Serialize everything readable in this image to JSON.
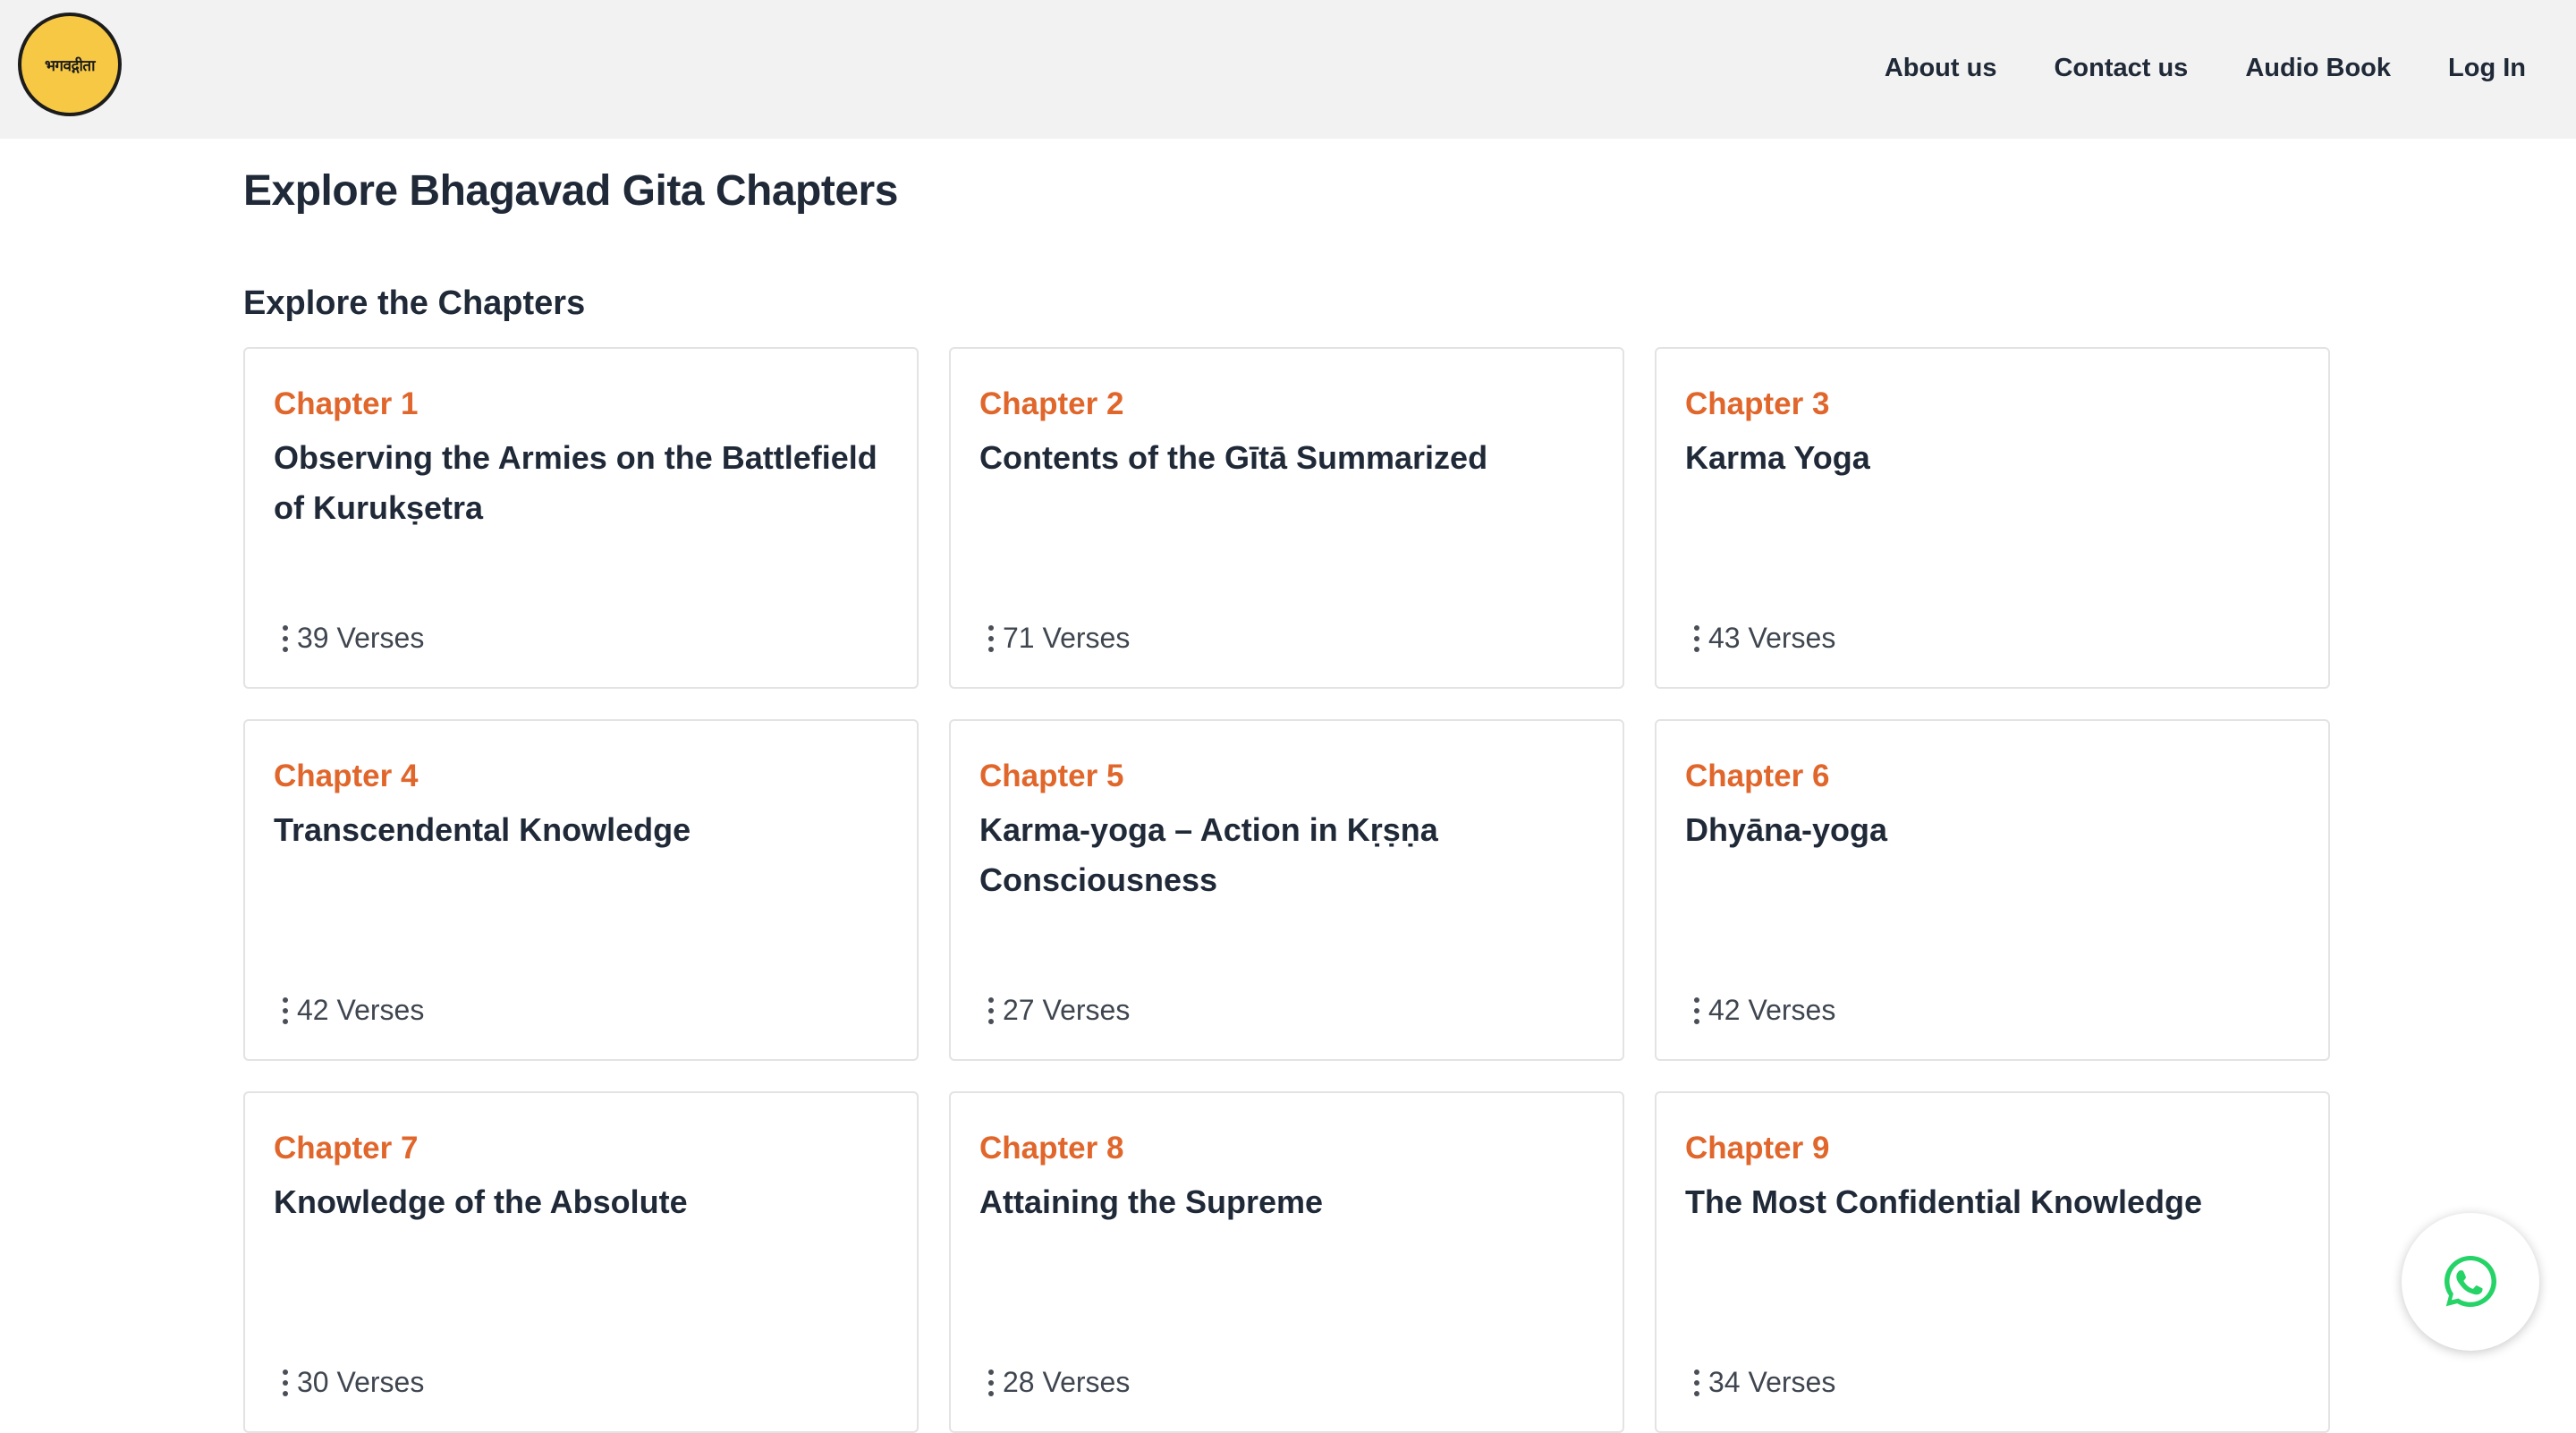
{
  "header": {
    "logo_text": "भगवद्गीता",
    "nav": [
      {
        "label": "About us"
      },
      {
        "label": "Contact us"
      },
      {
        "label": "Audio Book"
      },
      {
        "label": "Log In"
      }
    ]
  },
  "main": {
    "page_title": "Explore Bhagavad Gita Chapters",
    "section_title": "Explore the Chapters",
    "chapters": [
      {
        "number": "Chapter 1",
        "title": "Observing the Armies on the Battlefield of Kurukṣetra",
        "verses": "39 Verses"
      },
      {
        "number": "Chapter 2",
        "title": "Contents of the Gītā Summarized",
        "verses": "71 Verses"
      },
      {
        "number": "Chapter 3",
        "title": "Karma Yoga",
        "verses": "43 Verses"
      },
      {
        "number": "Chapter 4",
        "title": "Transcendental Knowledge",
        "verses": "42 Verses"
      },
      {
        "number": "Chapter 5",
        "title": "Karma-yoga – Action in Kṛṣṇa Consciousness",
        "verses": "27 Verses"
      },
      {
        "number": "Chapter 6",
        "title": "Dhyāna-yoga",
        "verses": "42 Verses"
      },
      {
        "number": "Chapter 7",
        "title": "Knowledge of the Absolute",
        "verses": "30 Verses"
      },
      {
        "number": "Chapter 8",
        "title": "Attaining the Supreme",
        "verses": "28 Verses"
      },
      {
        "number": "Chapter 9",
        "title": "The Most Confidential Knowledge",
        "verses": "34 Verses"
      }
    ]
  },
  "icons": {
    "verses_icon": "vertical-dots-icon",
    "chat_icon": "whatsapp-icon"
  },
  "colors": {
    "chapter_accent": "#e0662b",
    "logo_bg": "#f7c843",
    "whatsapp_green": "#25d366"
  }
}
